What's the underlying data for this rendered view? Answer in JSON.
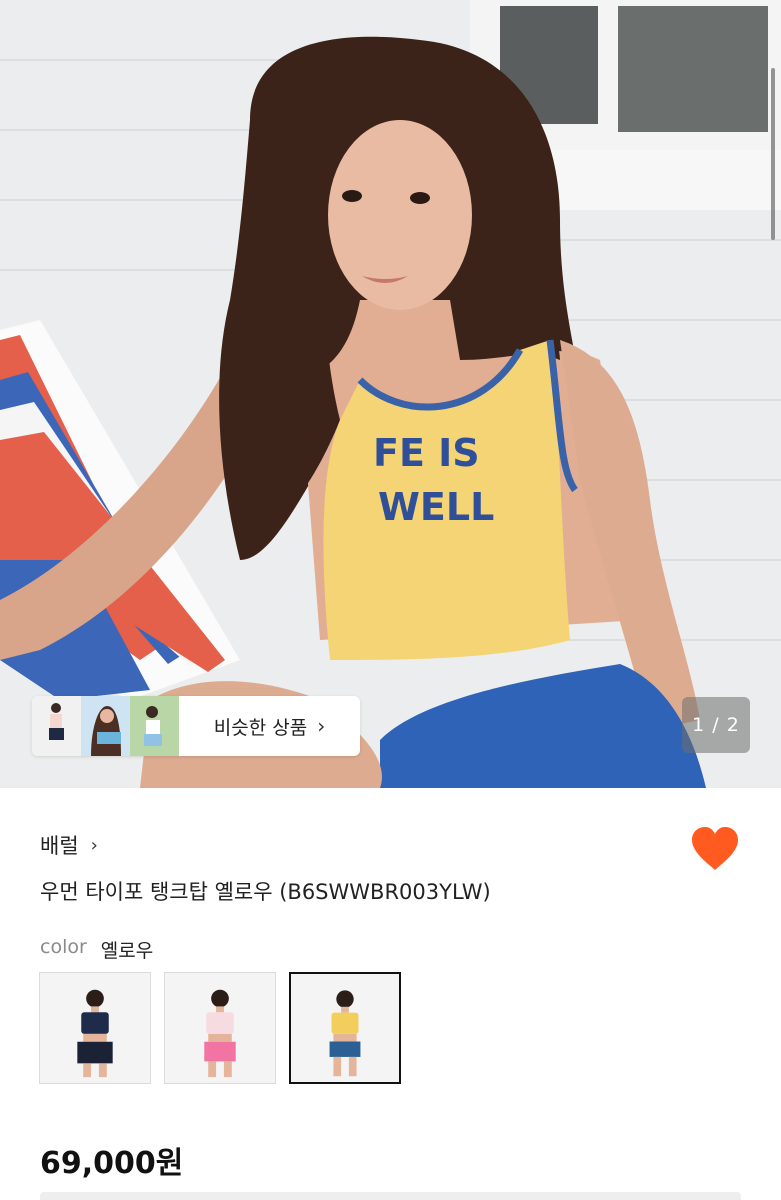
{
  "gallery": {
    "counter": "1 / 2",
    "similar_label": "비슷한 상품",
    "similar_icon": "chevron-right-icon",
    "shirt_print_line1": "FE IS",
    "shirt_print_line2": "WELL"
  },
  "product": {
    "brand": "배럴",
    "brand_icon": "chevron-right-icon",
    "title": "우먼 타이포 탱크탑 옐로우 (B6SWWBR003YLW)",
    "wishlist_icon": "heart-icon",
    "wishlist_color": "#ff5a1f",
    "color_key": "color",
    "color_value": "옐로우",
    "price": "69,000원"
  },
  "colors": {
    "accent": "#ff5a1f",
    "selected_border": "#111111"
  }
}
